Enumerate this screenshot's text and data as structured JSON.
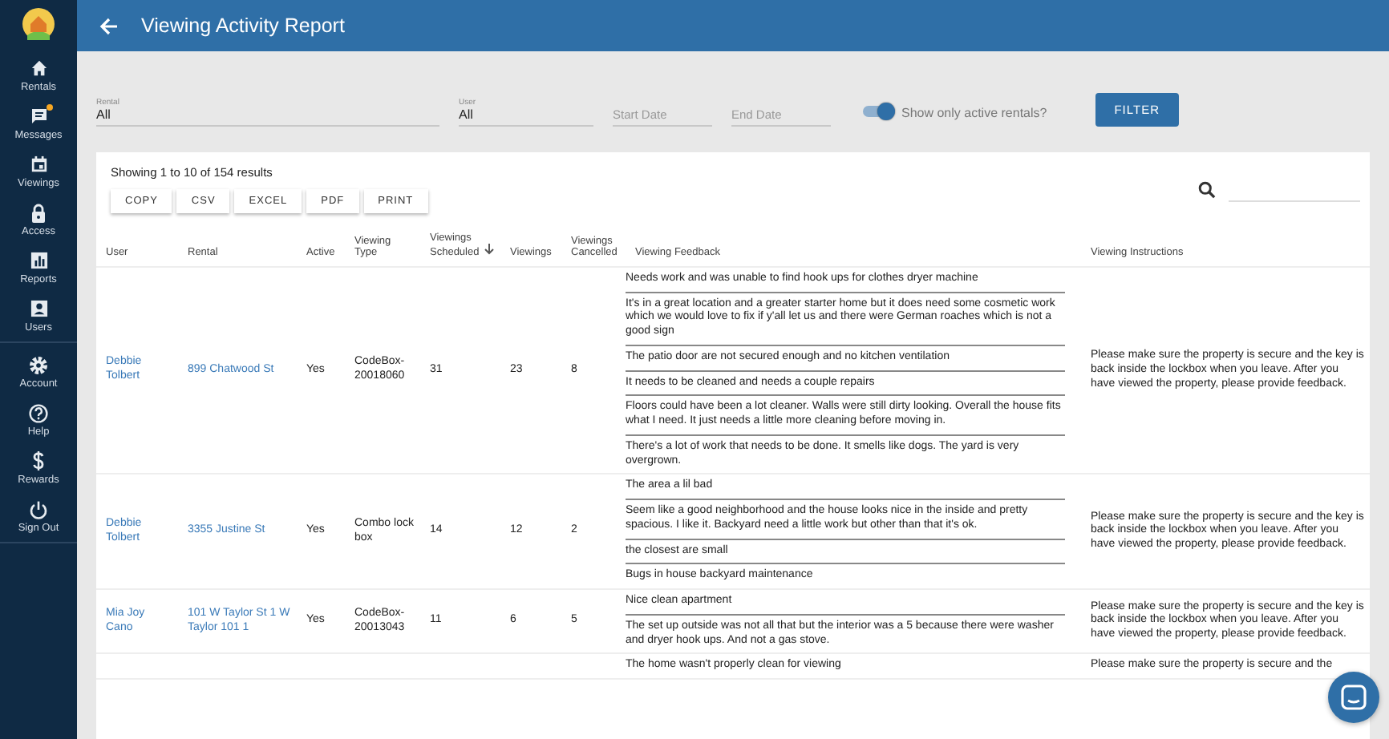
{
  "header": {
    "title": "Viewing Activity Report"
  },
  "sidebar": {
    "items": [
      {
        "label": "Rentals",
        "notification": false
      },
      {
        "label": "Messages",
        "notification": true
      },
      {
        "label": "Viewings",
        "notification": false
      },
      {
        "label": "Access",
        "notification": false
      },
      {
        "label": "Reports",
        "notification": false
      },
      {
        "label": "Users",
        "notification": false
      },
      {
        "label": "Account",
        "notification": false
      },
      {
        "label": "Help",
        "notification": false
      },
      {
        "label": "Rewards",
        "notification": false
      },
      {
        "label": "Sign Out",
        "notification": false
      }
    ]
  },
  "filters": {
    "rental": {
      "label": "Rental",
      "value": "All"
    },
    "user": {
      "label": "User",
      "value": "All"
    },
    "start_date": {
      "placeholder": "Start Date"
    },
    "end_date": {
      "placeholder": "End Date"
    },
    "active_toggle": {
      "label": "Show only active rentals?",
      "on": true
    },
    "filter_button": "FILTER"
  },
  "table": {
    "summary": "Showing 1 to 10 of 154 results",
    "export_buttons": [
      "COPY",
      "CSV",
      "EXCEL",
      "PDF",
      "PRINT"
    ],
    "columns": [
      {
        "label": "User",
        "kind": "link",
        "sorted": false
      },
      {
        "label": "Rental",
        "kind": "link",
        "sorted": false
      },
      {
        "label": "Active",
        "kind": "text",
        "sorted": false
      },
      {
        "label": "Viewing Type",
        "kind": "text",
        "sorted": false
      },
      {
        "label": "Viewings Scheduled",
        "kind": "text",
        "sorted": true
      },
      {
        "label": "Viewings",
        "kind": "text",
        "sorted": false
      },
      {
        "label": "Viewings Cancelled",
        "kind": "text",
        "sorted": false
      },
      {
        "label": "Viewing Feedback",
        "kind": "list",
        "sorted": false
      },
      {
        "label": "Viewing Instructions",
        "kind": "text",
        "sorted": false
      }
    ],
    "rows": [
      {
        "cells": [
          "Debbie Tolbert",
          "899 Chatwood St",
          "Yes",
          "CodeBox-20018060",
          "31",
          "23",
          "8",
          [
            "Needs work and was unable to find hook ups for clothes dryer machine",
            "It's in a great location and a greater starter home but it does need some cosmetic work which we would love to fix if y'all let us and there were German roaches which is not a good sign",
            "The patio door are not secured enough and no kitchen ventilation",
            "It needs to be cleaned and needs a couple repairs",
            "Floors could have been a lot cleaner. Walls were still dirty looking. Overall the house fits what I need. It just needs a little more cleaning before moving in.",
            "There's a lot of work that needs to be done. It smells like dogs. The yard is very overgrown."
          ],
          "Please make sure the property is secure and the key is back inside the lockbox when you leave. After you have viewed the property, please provide feedback."
        ]
      },
      {
        "cells": [
          "Debbie Tolbert",
          "3355 Justine St",
          "Yes",
          "Combo lock box",
          "14",
          "12",
          "2",
          [
            "The area a lil bad",
            "Seem like a good neighborhood and the house looks nice in the inside and pretty spacious. I like it. Backyard need a little work but other than that it's ok.",
            "the closest are small",
            "Bugs in house backyard maintenance"
          ],
          "Please make sure the property is secure and the key is back inside the lockbox when you leave. After you have viewed the property, please provide feedback."
        ]
      },
      {
        "cells": [
          "Mia Joy Cano",
          "101 W Taylor St 1 W Taylor 101 1",
          "Yes",
          "CodeBox-20013043",
          "11",
          "6",
          "5",
          [
            "Nice clean apartment",
            "The set up outside was not all that but the interior was a 5 because there were washer and dryer hook ups. And not a gas stove."
          ],
          "Please make sure the property is secure and the key is back inside the lockbox when you leave. After you have viewed the property, please provide feedback."
        ]
      },
      {
        "cells": [
          "",
          "",
          "",
          "",
          "",
          "",
          "",
          [
            "The home wasn't properly clean for viewing"
          ],
          "Please make sure the property is secure and the"
        ]
      }
    ]
  }
}
